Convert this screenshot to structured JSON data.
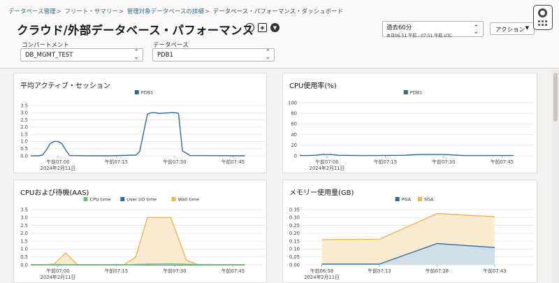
{
  "breadcrumb": {
    "items": [
      "データベース管理",
      "フリート・サマリー",
      "管理対象データベースの詳細"
    ],
    "separator": ">",
    "current": "データベース・パフォーマンス・ダッシュボード"
  },
  "page_title": "クラウド/外部データベース・パフォーマンス",
  "icons": [
    "info-icon",
    "cube-icon",
    "filter-icon"
  ],
  "compartment": {
    "label": "コンパートメント",
    "value": "DB_MGMT_TEST"
  },
  "database": {
    "label": "データベース",
    "value": "PDB1"
  },
  "time_range": {
    "value": "過去60分",
    "detail": "本日06:51 午前 - 07:51 午前 UTC"
  },
  "actions_label": "アクション",
  "colors": {
    "blue": "#2c6c9a",
    "blue_fill": "#c8dcea",
    "green": "#6dbf6f",
    "orange": "#efb450",
    "orange_fill": "#fbe8cb",
    "grid": "#e4e2e0"
  },
  "chart_data": [
    {
      "id": "avg-active-sessions",
      "type": "line",
      "title": "平均アクティブ・セッション",
      "xlabel": "",
      "ylabel": "",
      "ylim": [
        0,
        3.5
      ],
      "yticks": [
        0,
        0.5,
        1.0,
        1.5,
        2.0,
        2.5,
        3.0,
        3.5
      ],
      "ytick_labels": [
        "0.0",
        "0.5",
        "1.0",
        "1.5",
        "2.0",
        "2.5",
        "3.0",
        "3.5"
      ],
      "xlim": [
        0,
        60
      ],
      "xticks": [
        {
          "x": 7,
          "label": "午前07:00",
          "sub": "2024年2月11日"
        },
        {
          "x": 22,
          "label": "午前07:15"
        },
        {
          "x": 37,
          "label": "午前07:30"
        },
        {
          "x": 52,
          "label": "午前07:45"
        }
      ],
      "legend": "top-center",
      "grid": true,
      "series": [
        {
          "name": "PDB1",
          "color": "#2c6c9a",
          "x": [
            0,
            2,
            3,
            4,
            5,
            6,
            7,
            8,
            9,
            10,
            15,
            20,
            27,
            28,
            29,
            30,
            31,
            32,
            33,
            36,
            37,
            38,
            39,
            41,
            55
          ],
          "y": [
            0,
            0,
            0.05,
            0.4,
            0.85,
            1.0,
            1.0,
            0.85,
            0.4,
            0.02,
            0,
            0,
            0.05,
            0.3,
            1.6,
            2.9,
            3.0,
            3.0,
            2.95,
            3.0,
            3.0,
            2.95,
            0.35,
            0.02,
            0
          ]
        }
      ]
    },
    {
      "id": "cpu-utilization",
      "type": "line",
      "title": "CPU使用率(%)",
      "xlabel": "",
      "ylabel": "",
      "ylim": [
        0,
        100
      ],
      "yticks": [
        0,
        20,
        40,
        60,
        80,
        100
      ],
      "ytick_labels": [
        "0",
        "20",
        "40",
        "60",
        "80",
        "100"
      ],
      "xlim": [
        0,
        60
      ],
      "xticks": [
        {
          "x": 7,
          "label": "午前07:00",
          "sub": "2024年2月11日"
        },
        {
          "x": 22,
          "label": "午前07:15"
        },
        {
          "x": 37,
          "label": "午前07:30"
        },
        {
          "x": 52,
          "label": "午前07:45"
        }
      ],
      "legend": "top-center",
      "grid": true,
      "series": [
        {
          "name": "PDB1",
          "color": "#2c6c9a",
          "x": [
            0,
            2,
            4,
            6,
            8,
            10,
            15,
            20,
            27,
            29,
            31,
            33,
            36,
            38,
            40,
            42,
            55
          ],
          "y": [
            0.5,
            0.5,
            1,
            2.5,
            2.5,
            1,
            0.5,
            0.5,
            1,
            2,
            2.5,
            2.5,
            2.5,
            2.3,
            1.5,
            0.5,
            0.5
          ]
        }
      ]
    },
    {
      "id": "cpu-and-wait",
      "type": "area",
      "title": "CPUおよび待機(AAS)",
      "xlabel": "",
      "ylabel": "",
      "ylim": [
        0,
        3.5
      ],
      "yticks": [
        0,
        0.5,
        1.0,
        1.5,
        2.0,
        2.5,
        3.0,
        3.5
      ],
      "ytick_labels": [
        "0.0",
        "0.5",
        "1.0",
        "1.5",
        "2.0",
        "2.5",
        "3.0",
        "3.5"
      ],
      "xlim": [
        0,
        60
      ],
      "xticks": [
        {
          "x": 7,
          "label": "午前07:00",
          "sub": "2024年2月11日"
        },
        {
          "x": 22,
          "label": "午前07:15"
        },
        {
          "x": 37,
          "label": "午前07:30"
        },
        {
          "x": 52,
          "label": "午前07:45"
        }
      ],
      "legend": "top-center",
      "grid": true,
      "series": [
        {
          "name": "CPU time",
          "color": "#6dbf6f",
          "x": [
            0,
            7,
            12,
            24,
            30,
            36,
            42,
            55
          ],
          "y": [
            0,
            0.02,
            0,
            0,
            0.05,
            0.06,
            0.02,
            0
          ]
        },
        {
          "name": "User I/O time",
          "color": "#2c6c9a",
          "x": [
            0,
            55
          ],
          "y": [
            0,
            0
          ]
        },
        {
          "name": "Wall time",
          "color": "#efb450",
          "x": [
            0,
            3,
            6,
            9,
            12,
            18,
            24,
            27,
            30,
            36,
            40,
            43,
            55
          ],
          "y": [
            0,
            0,
            0.05,
            0.75,
            0,
            0,
            0,
            0.5,
            3.0,
            3.0,
            0.3,
            0,
            0
          ]
        }
      ]
    },
    {
      "id": "memory-usage",
      "type": "area",
      "title": "メモリー使用量(GB)",
      "xlabel": "",
      "ylabel": "",
      "ylim": [
        0,
        0.35
      ],
      "yticks": [
        0,
        0.05,
        0.1,
        0.15,
        0.2,
        0.25,
        0.3,
        0.35
      ],
      "ytick_labels": [
        "0.00",
        "0.05",
        "0.10",
        "0.15",
        "0.20",
        "0.25",
        "0.30",
        "0.35"
      ],
      "xlim": [
        0,
        60
      ],
      "xticks": [
        {
          "x": 5,
          "label": "午前06:58",
          "sub": "2024年2月11日"
        },
        {
          "x": 20,
          "label": "午前07:13"
        },
        {
          "x": 35,
          "label": "午前07:28"
        },
        {
          "x": 50,
          "label": "午前07:43"
        }
      ],
      "legend": "top-center",
      "grid": true,
      "series": [
        {
          "name": "PGA",
          "color": "#2c6c9a",
          "x": [
            5,
            20,
            35,
            50
          ],
          "y": [
            0.005,
            0.005,
            0.135,
            0.11
          ]
        },
        {
          "name": "SGA",
          "color": "#efb450",
          "x": [
            5,
            20,
            35,
            50
          ],
          "y": [
            0.16,
            0.162,
            0.325,
            0.305
          ]
        }
      ]
    }
  ]
}
